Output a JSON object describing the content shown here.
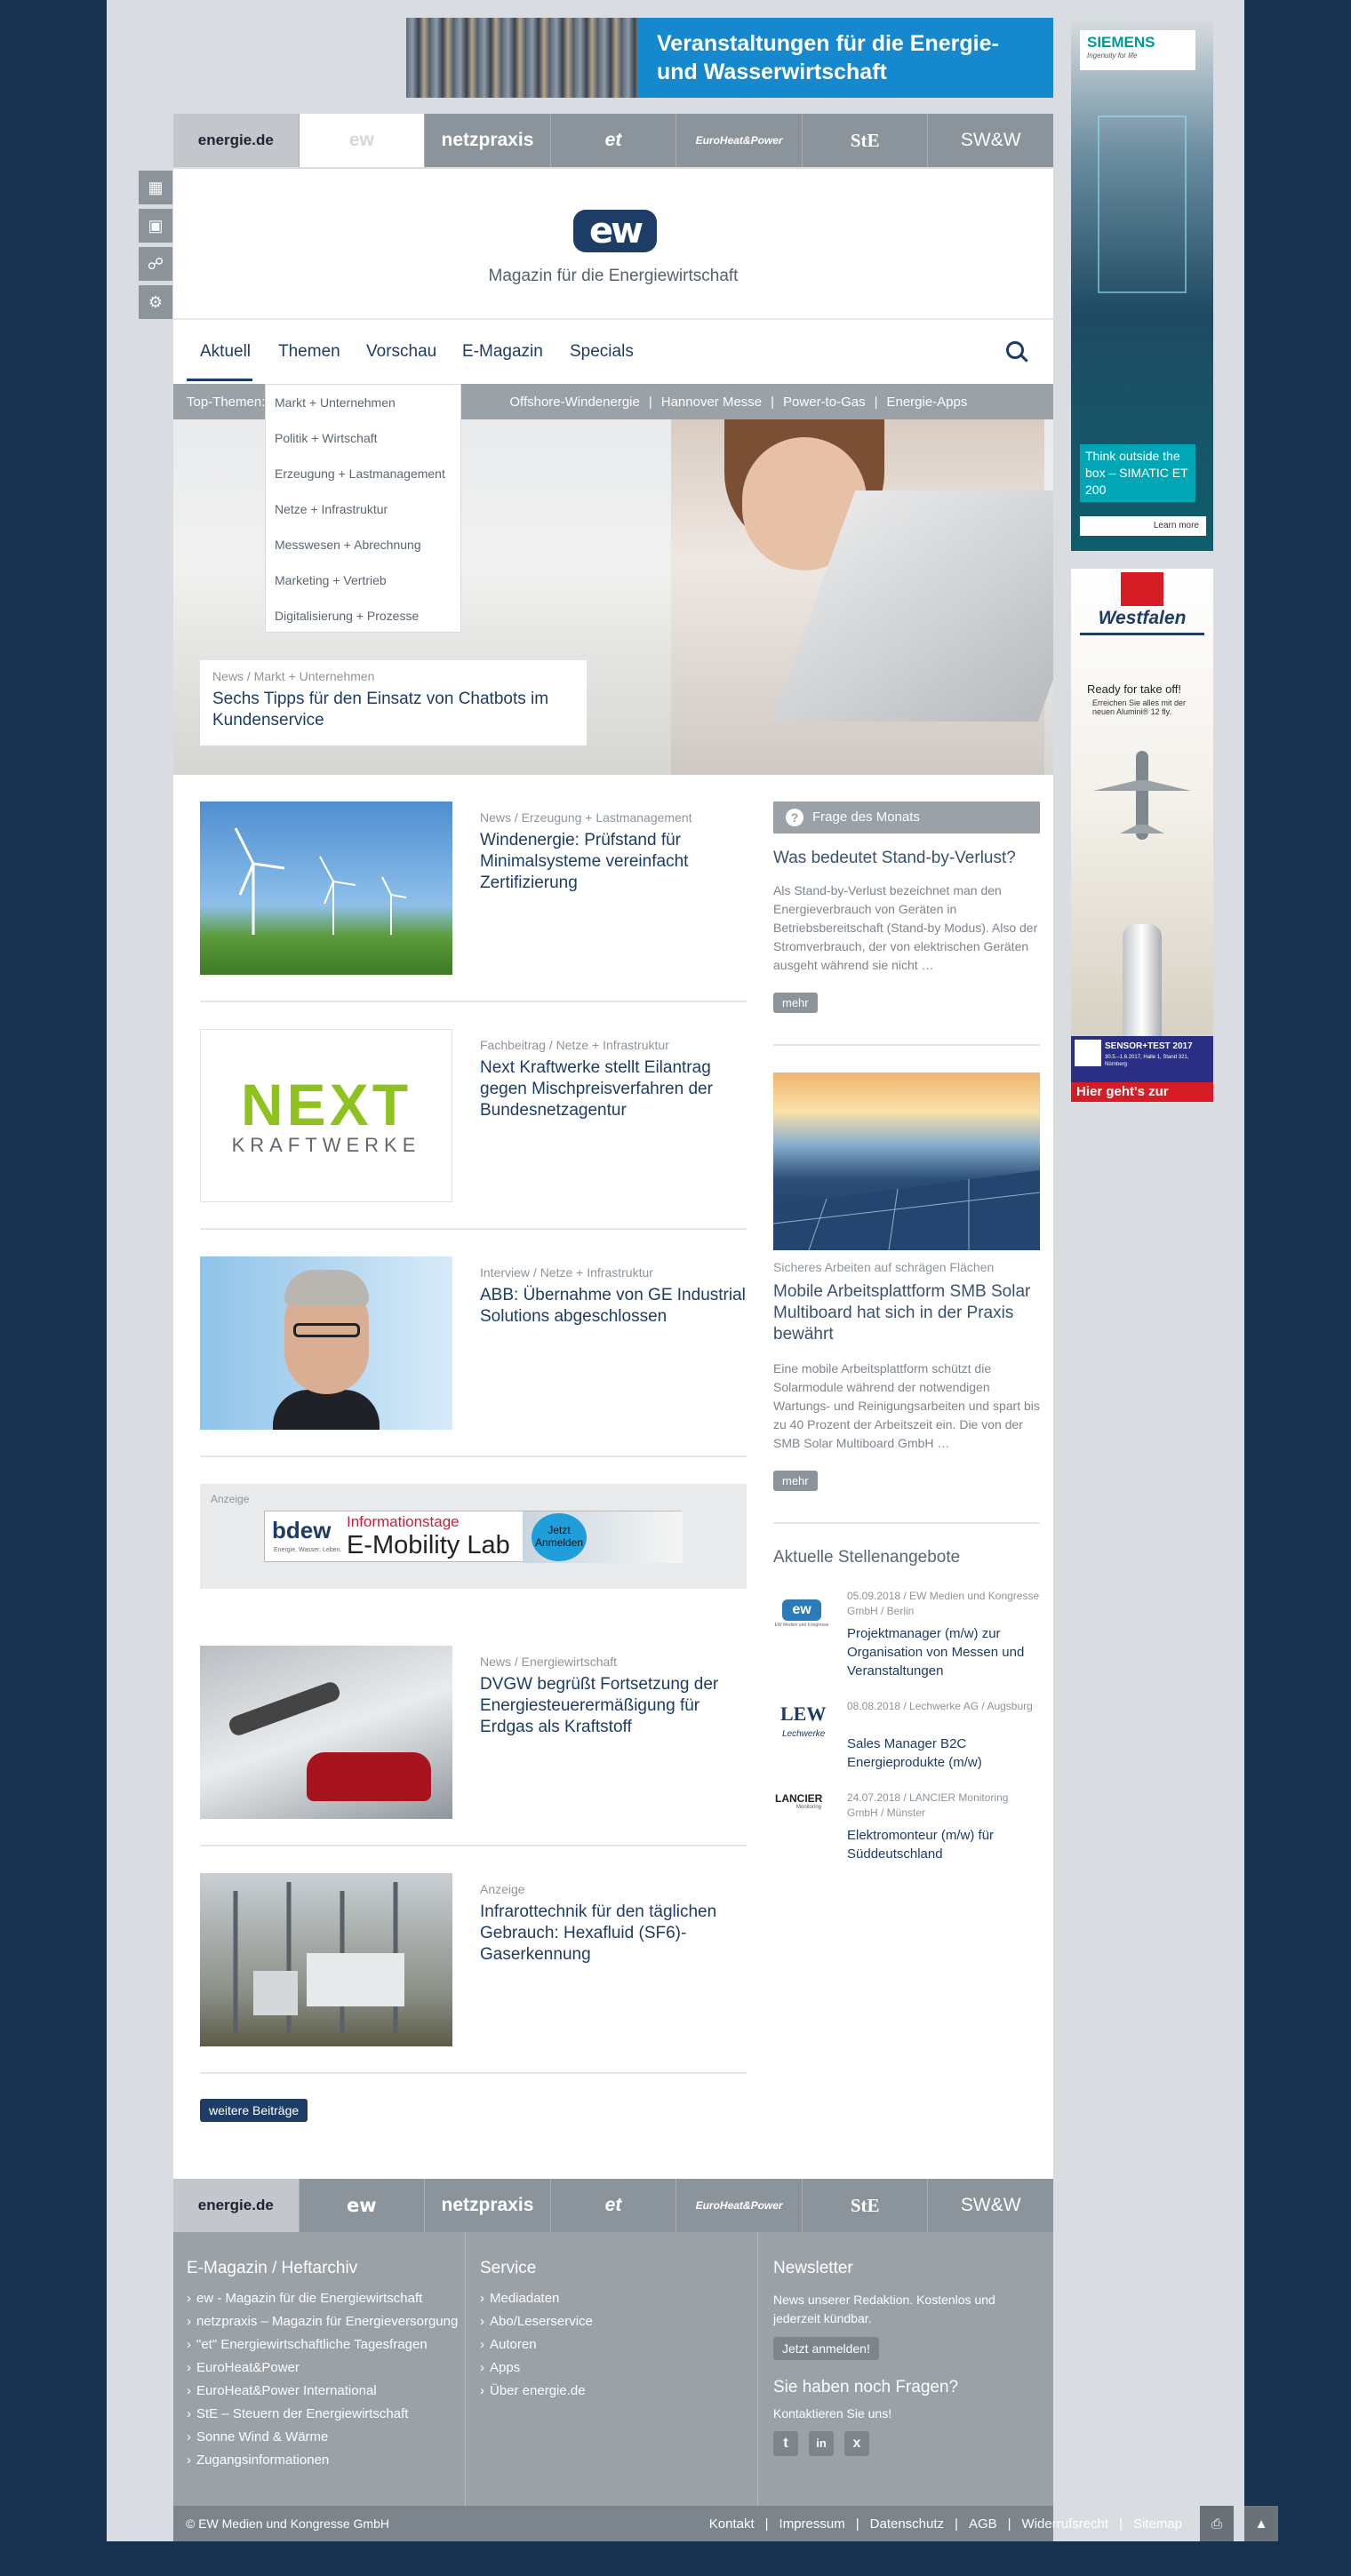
{
  "banner": {
    "text": "Veranstaltungen für die Energie- und Wasserwirtschaft"
  },
  "sidebar_icons": [
    "calendar-icon",
    "briefcase-icon",
    "handshake-icon",
    "gear-icon"
  ],
  "portals": [
    "energie.de",
    "ew",
    "netzpraxis",
    "et",
    "EuroHeat&Power",
    "StE",
    "SW&W"
  ],
  "site": {
    "tagline": "Magazin für die Energiewirtschaft"
  },
  "menu": [
    {
      "label": "Aktuell",
      "active": true
    },
    {
      "label": "Themen"
    },
    {
      "label": "Vorschau"
    },
    {
      "label": "E-Magazin"
    },
    {
      "label": "Specials"
    }
  ],
  "top_themes": {
    "label": "Top-Themen:",
    "items": [
      "Offshore-Windenergie",
      "Hannover Messe",
      "Power-to-Gas",
      "Energie-Apps"
    ]
  },
  "themen_dropdown": [
    "Markt + Unternehmen",
    "Politik + Wirtschaft",
    "Erzeugung + Lastmanagement",
    "Netze + Infrastruktur",
    "Messwesen + Abrechnung",
    "Marketing + Vertrieb",
    "Digitalisierung + Prozesse"
  ],
  "hero": {
    "meta": "News / Markt + Unternehmen",
    "title": "Sechs Tipps für den Einsatz von Chatbots im Kundenservice"
  },
  "articles": [
    {
      "meta": "News / Erzeugung + Lastmanagement",
      "title": "Windenergie: Prüfstand für Minimalsysteme vereinfacht Zertifizierung"
    },
    {
      "meta": "Fachbeitrag / Netze + Infrastruktur",
      "title": "Next Kraftwerke stellt Eilantrag gegen Mischpreisverfahren der Bundesnetzagentur"
    },
    {
      "meta": "Interview / Netze + Infrastruktur",
      "title": "ABB: Übernahme von GE Industrial Solutions abgeschlossen"
    },
    {
      "meta": "News / Energiewirtschaft",
      "title": "DVGW begrüßt Fortsetzung der Energiesteuerermäßigung für Erdgas als Kraftstoff"
    },
    {
      "meta": "Anzeige",
      "title": "Infrarottechnik für den täglichen Gebrauch: Hexafluid (SF6)-Gaserkennung"
    }
  ],
  "next_logo": {
    "top": "NEXT",
    "bottom": "KRAFTWERKE"
  },
  "ad_inline": {
    "label": "Anzeige",
    "brand": "bdew",
    "brand_sub": "Energie. Wasser. Leben.",
    "title": "Informationstage",
    "subtitle": "E-Mobility Lab",
    "cta": "Jetzt Anmelden"
  },
  "more_posts": "weitere Beiträge",
  "question": {
    "header": "Frage des Monats",
    "title": "Was bedeutet Stand-by-Verlust?",
    "text": "Als Stand-by-Verlust bezeichnet man den Energieverbrauch von Geräten in Betriebsbereitschaft (Stand-by Modus). Also der Stromverbrauch, der von elektrischen Geräten ausgeht während sie nicht …",
    "more": "mehr"
  },
  "side_article": {
    "meta": "Sicheres Arbeiten auf schrägen Flächen",
    "title": "Mobile Arbeitsplattform SMB Solar Multiboard hat sich in der Praxis bewährt",
    "text": "Eine mobile Arbeitsplattform schützt die Solarmodule während der notwendigen Wartungs- und Reinigungsarbeiten und spart bis zu 40 Prozent der Arbeitszeit ein. Die von der SMB Solar Multiboard GmbH …",
    "more": "mehr"
  },
  "jobs": {
    "title": "Aktuelle Stellenangebote",
    "items": [
      {
        "logo": "ew",
        "logo_sub": "EW Medien und Kongresse",
        "meta": "05.09.2018 / EW Medien und Kongresse GmbH / Berlin",
        "title": "Projektmanager (m/w) zur Organisation von Messen und Veranstaltungen"
      },
      {
        "logo": "LEW",
        "logo_sub": "Lechwerke",
        "meta": "08.08.2018 / Lechwerke AG / Augsburg",
        "title": "Sales Manager B2C Energieprodukte (m/w)"
      },
      {
        "logo": "LANCIER",
        "logo_sub": "Monitoring",
        "meta": "24.07.2018 / LANCIER Monitoring GmbH / Münster",
        "title": "Elektromonteur (m/w) für Süddeutschland"
      }
    ]
  },
  "ad_siemens": {
    "brand": "SIEMENS",
    "tag": "Ingenuity for life",
    "text": "Think outside the box – SIMATIC ET 200",
    "cta": "Learn more"
  },
  "ad_westfalen": {
    "brand": "Westfalen",
    "text1": "Ready for take off!",
    "text2": "Erreichen Sie alles mit der neuen Alumini® 12 fly.",
    "fair": "SENSOR+TEST 2017",
    "fair_sub": "30.5.–1.6.2017, Halle 1, Stand 321, Nürnberg",
    "cta": "Hier geht's zur"
  },
  "footer": {
    "col1": {
      "title": "E-Magazin / Heftarchiv",
      "links": [
        "ew - Magazin für die Energiewirtschaft",
        "netzpraxis – Magazin für Energieversorgung",
        "\"et\" Energiewirtschaftliche Tagesfragen",
        "EuroHeat&Power",
        "EuroHeat&Power International",
        "StE – Steuern der Energiewirtschaft",
        "Sonne Wind & Wärme",
        "Zugangsinformationen"
      ]
    },
    "col2": {
      "title": "Service",
      "links": [
        "Mediadaten",
        "Abo/Leserservice",
        "Autoren",
        "Apps",
        "Über energie.de"
      ]
    },
    "col3": {
      "title": "Newsletter",
      "text": "News unserer Redaktion. Kostenlos und jederzeit kündbar.",
      "button": "Jetzt anmelden!",
      "q": "Sie haben noch Fragen?",
      "contact": "Kontaktieren Sie uns!"
    },
    "copyright": "© EW Medien und Kongresse GmbH",
    "links": [
      "Kontakt",
      "Impressum",
      "Datenschutz",
      "AGB",
      "Widerrufsrecht",
      "Sitemap"
    ]
  }
}
